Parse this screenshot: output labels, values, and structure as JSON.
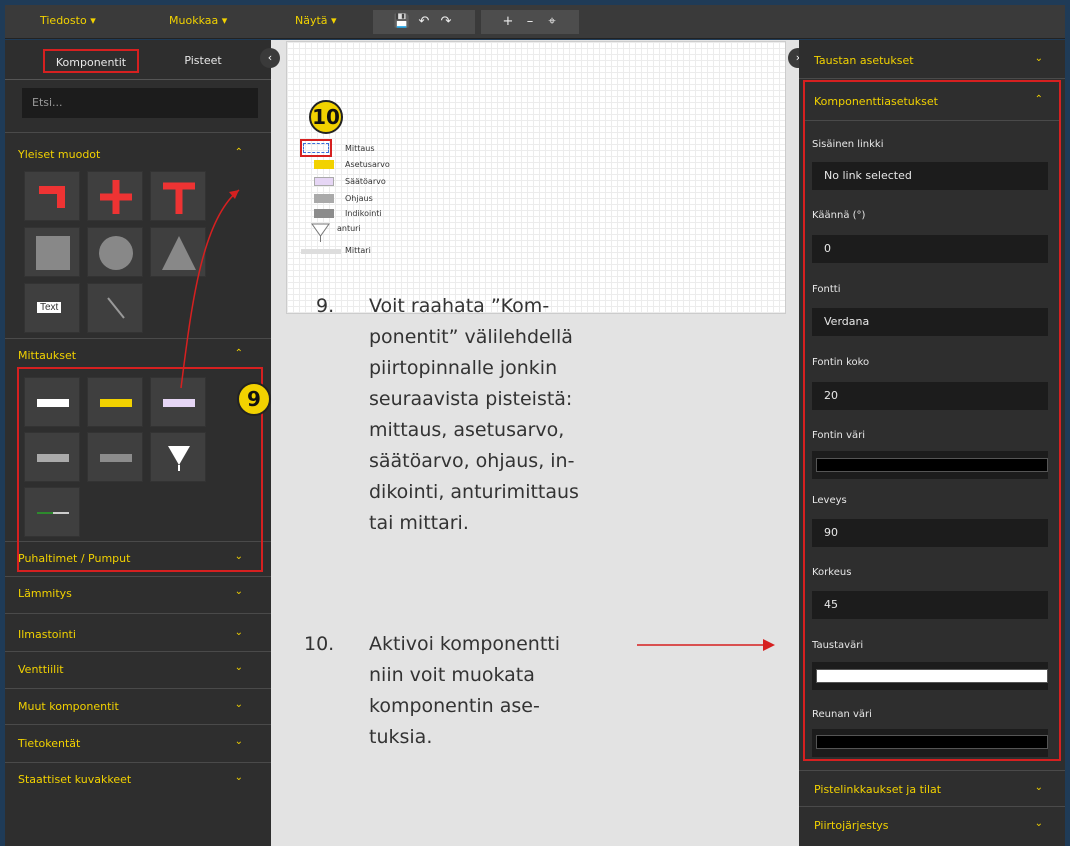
{
  "menu": {
    "file": "Tiedosto",
    "edit": "Muokkaa",
    "view": "Näytä"
  },
  "toolbar": {
    "icons": [
      "save-icon",
      "undo-icon",
      "redo-icon",
      "zoom-in-icon",
      "zoom-out-icon",
      "fit-icon"
    ]
  },
  "left": {
    "tab_components": "Komponentit",
    "tab_points": "Pisteet",
    "search_placeholder": "Etsi...",
    "sections": {
      "general": "Yleiset muodot",
      "measurements": "Mittaukset",
      "fans": "Puhaltimet / Pumput",
      "heating": "Lämmitys",
      "ventilation": "Ilmastointi",
      "valves": "Venttiilit",
      "other": "Muut komponentit",
      "datafields": "Tietokentät",
      "static": "Staattiset kuvakkeet"
    },
    "text_tile": "Text"
  },
  "canvas": {
    "legend": [
      "Mittaus",
      "Asetusarvo",
      "Säätöarvo",
      "Ohjaus",
      "Indikointi",
      "anturi",
      "Mittari"
    ],
    "badge9": "9",
    "badge10": "10",
    "step9_num": "9.",
    "step9_lines": [
      "Voit raahata ”Kom-",
      "ponentit” välilehdellä",
      "piirtopinnalle  jonkin",
      "seuraavista pisteistä:",
      "mittaus, asetusarvo,",
      "säätöarvo, ohjaus, in-",
      "dikointi, anturimittaus",
      "tai mittari."
    ],
    "step10_num": "10.",
    "step10_lines": [
      "Aktivoi komponentti",
      "niin voit muokata",
      "komponentin ase-",
      "tuksia."
    ]
  },
  "right": {
    "bg_settings": "Taustan asetukset",
    "component_settings": "Komponenttiasetukset",
    "internal_link_label": "Sisäinen linkki",
    "internal_link_value": "No link selected",
    "rotate_label": "Käännä (°)",
    "rotate_value": "0",
    "font_label": "Fontti",
    "font_value": "Verdana",
    "font_size_label": "Fontin koko",
    "font_size_value": "20",
    "font_color_label": "Fontin väri",
    "width_label": "Leveys",
    "width_value": "90",
    "height_label": "Korkeus",
    "height_value": "45",
    "bg_color_label": "Taustaväri",
    "border_color_label": "Reunan väri",
    "point_links": "Pistelinkkaukset ja tilat",
    "draw_order": "Piirtojärjestys"
  },
  "colors": {
    "accent": "#f2d200",
    "annotation": "#d62020",
    "panel": "#2e2e2e",
    "frame": "#1f3b57"
  }
}
